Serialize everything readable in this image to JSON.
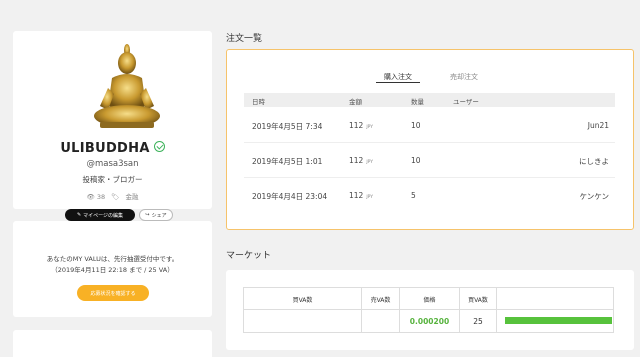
{
  "profile": {
    "name": "ULIBUDDHA",
    "handle": "@masa3san",
    "job": "投稿家・ブロガー",
    "views": "38",
    "tag": "金融",
    "edit_label": "マイページの編集",
    "share_label": "シェア"
  },
  "preorder": {
    "line1": "あなたのMY VALUは、先行抽選受付中です。",
    "line2": "（2019年4月11日 22:18 まで / 25 VA）",
    "button_label": "応募状況を確認する"
  },
  "orders": {
    "title": "注文一覧",
    "tabs": [
      "購入注文",
      "売却注文"
    ],
    "columns": [
      "日時",
      "金額",
      "数量",
      "ユーザー"
    ],
    "rows": [
      {
        "date": "2019年4月5日 7:34",
        "amount": "112",
        "unit": "JPY",
        "qty": "10",
        "user": "Jun21"
      },
      {
        "date": "2019年4月5日 1:01",
        "amount": "112",
        "unit": "JPY",
        "qty": "10",
        "user": "にしきよ"
      },
      {
        "date": "2019年4月4日 23:04",
        "amount": "112",
        "unit": "JPY",
        "qty": "5",
        "user": "ケンケン"
      }
    ]
  },
  "market": {
    "title": "マーケット",
    "columns": [
      "買VA数",
      "売VA数",
      "価格",
      "買VA数"
    ],
    "price": "0.000200",
    "qty": "25",
    "bar_fraction": 1.0,
    "bar_color": "#57c23c"
  },
  "colors": {
    "accent_orange": "#f8b125",
    "verified_green": "#3db35b",
    "price_green": "#57b33e"
  }
}
